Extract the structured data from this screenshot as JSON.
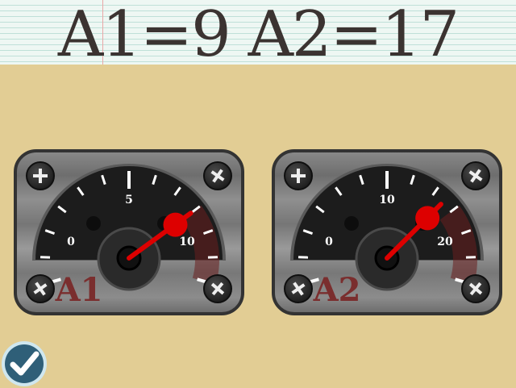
{
  "header": {
    "equation": "A1=9 A2=17"
  },
  "gauges": [
    {
      "id": "A1",
      "label": "A1",
      "ticks": [
        "0",
        "5",
        "10"
      ],
      "max": 12,
      "value": 9
    },
    {
      "id": "A2",
      "label": "A2",
      "ticks": [
        "0",
        "10",
        "20"
      ],
      "max": 24,
      "value": 17
    }
  ],
  "colors": {
    "needle": "#dd0000",
    "label": "#7a2e2e",
    "danger_zone": "#6a1f1f",
    "check_fill": "#2f5f78",
    "check_ring": "#cfe7ef"
  },
  "icons": {
    "submit": "check-icon",
    "screws": "screw-icon"
  }
}
